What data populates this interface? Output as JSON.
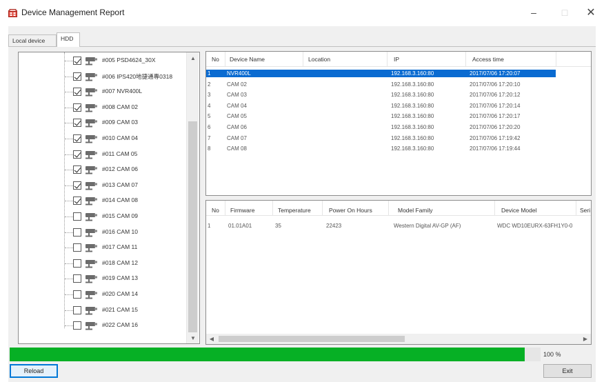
{
  "window": {
    "title": "Device Management Report",
    "minimize": "–",
    "maximize": "□",
    "close": "✕"
  },
  "tabs": [
    {
      "label": "Local device",
      "active": false
    },
    {
      "label": "HDD",
      "active": true
    }
  ],
  "tree": {
    "items": [
      {
        "label": "#005 PSD4624_30X",
        "checked": true
      },
      {
        "label": "#006 IPS420地捷通專0318",
        "checked": true
      },
      {
        "label": "#007 NVR400L",
        "checked": true
      },
      {
        "label": "#008 CAM 02",
        "checked": true
      },
      {
        "label": "#009 CAM 03",
        "checked": true
      },
      {
        "label": "#010 CAM 04",
        "checked": true
      },
      {
        "label": "#011 CAM 05",
        "checked": true
      },
      {
        "label": "#012 CAM 06",
        "checked": true
      },
      {
        "label": "#013 CAM 07",
        "checked": true
      },
      {
        "label": "#014 CAM 08",
        "checked": true
      },
      {
        "label": "#015 CAM 09",
        "checked": false
      },
      {
        "label": "#016 CAM 10",
        "checked": false
      },
      {
        "label": "#017 CAM 11",
        "checked": false
      },
      {
        "label": "#018 CAM 12",
        "checked": false
      },
      {
        "label": "#019 CAM 13",
        "checked": false
      },
      {
        "label": "#020 CAM 14",
        "checked": false
      },
      {
        "label": "#021 CAM 15",
        "checked": false
      },
      {
        "label": "#022 CAM 16",
        "checked": false
      }
    ]
  },
  "devices": {
    "columns": [
      "No",
      "Device Name",
      "Location",
      "IP",
      "Access time"
    ],
    "rows": [
      {
        "no": "1",
        "name": "NVR400L",
        "location": "",
        "ip": "192.168.3.160:80",
        "time": "2017/07/06 17:20:07",
        "selected": true
      },
      {
        "no": "2",
        "name": "CAM 02",
        "location": "",
        "ip": "192.168.3.160:80",
        "time": "2017/07/06 17:20:10",
        "selected": false
      },
      {
        "no": "3",
        "name": "CAM 03",
        "location": "",
        "ip": "192.168.3.160:80",
        "time": "2017/07/06 17:20:12",
        "selected": false
      },
      {
        "no": "4",
        "name": "CAM 04",
        "location": "",
        "ip": "192.168.3.160:80",
        "time": "2017/07/06 17:20:14",
        "selected": false
      },
      {
        "no": "5",
        "name": "CAM 05",
        "location": "",
        "ip": "192.168.3.160:80",
        "time": "2017/07/06 17:20:17",
        "selected": false
      },
      {
        "no": "6",
        "name": "CAM 06",
        "location": "",
        "ip": "192.168.3.160:80",
        "time": "2017/07/06 17:20:20",
        "selected": false
      },
      {
        "no": "7",
        "name": "CAM 07",
        "location": "",
        "ip": "192.168.3.160:80",
        "time": "2017/07/06 17:19:42",
        "selected": false
      },
      {
        "no": "8",
        "name": "CAM 08",
        "location": "",
        "ip": "192.168.3.160:80",
        "time": "2017/07/06 17:19:44",
        "selected": false
      }
    ]
  },
  "hdd": {
    "columns": [
      "No",
      "Firmware",
      "Temperature",
      "Power On Hours",
      "Model Family",
      "Device Model",
      "Seri"
    ],
    "rows": [
      {
        "no": "1",
        "firmware": "01.01A01",
        "temperature": "35",
        "power_on_hours": "22423",
        "model_family": "Western Digital AV-GP (AF)",
        "device_model": "WDC WD10EURX-63FH1Y0-0"
      }
    ]
  },
  "progress": {
    "percent": 0.97,
    "label": "100 %"
  },
  "buttons": {
    "reload": "Reload",
    "exit": "Exit"
  },
  "colors": {
    "selection": "#0a6bd1",
    "progress": "#06b025",
    "focus": "#0078d7"
  },
  "icons": {
    "title": "device-report-icon",
    "camera": "camera-icon"
  }
}
